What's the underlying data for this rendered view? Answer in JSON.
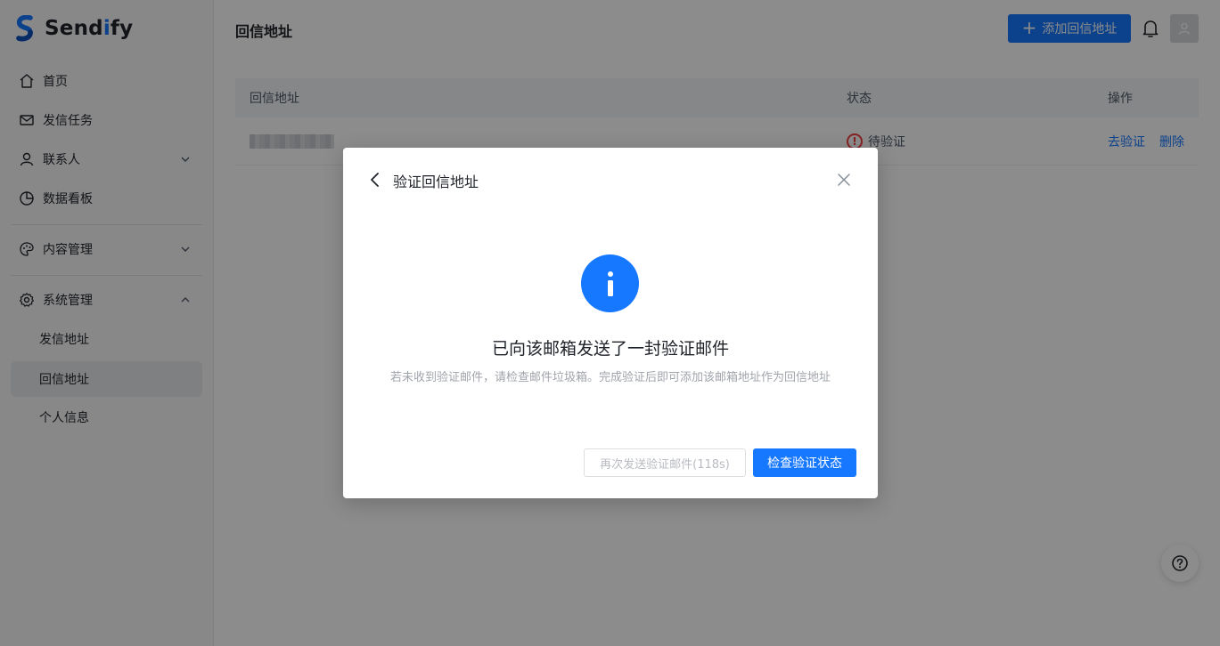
{
  "app": {
    "name_prefix": "Send",
    "name_accent": "i",
    "name_suffix": "fy"
  },
  "sidebar": {
    "items": [
      {
        "label": "首页",
        "icon": "home-icon"
      },
      {
        "label": "发信任务",
        "icon": "mail-icon"
      },
      {
        "label": "联系人",
        "icon": "user-icon"
      },
      {
        "label": "数据看板",
        "icon": "pie-chart-icon"
      },
      {
        "label": "内容管理",
        "icon": "palette-icon"
      },
      {
        "label": "系统管理",
        "icon": "gear-icon"
      }
    ],
    "sub_items": [
      {
        "label": "发信地址"
      },
      {
        "label": "回信地址",
        "active": true
      },
      {
        "label": "个人信息"
      }
    ]
  },
  "header": {
    "title": "回信地址",
    "add_button": "添加回信地址"
  },
  "table": {
    "columns": [
      "回信地址",
      "状态",
      "操作"
    ],
    "rows": [
      {
        "status": "待验证",
        "actions": [
          "去验证",
          "删除"
        ]
      }
    ]
  },
  "modal": {
    "title": "验证回信地址",
    "heading": "已向该邮箱发送了一封验证邮件",
    "description": "若未收到验证邮件，请检查邮件垃圾箱。完成验证后即可添加该邮箱地址作为回信地址",
    "resend_button": "再次发送验证邮件(118s)",
    "check_button": "检查验证状态"
  },
  "colors": {
    "primary": "#1677ff",
    "danger": "#f53f3f"
  }
}
